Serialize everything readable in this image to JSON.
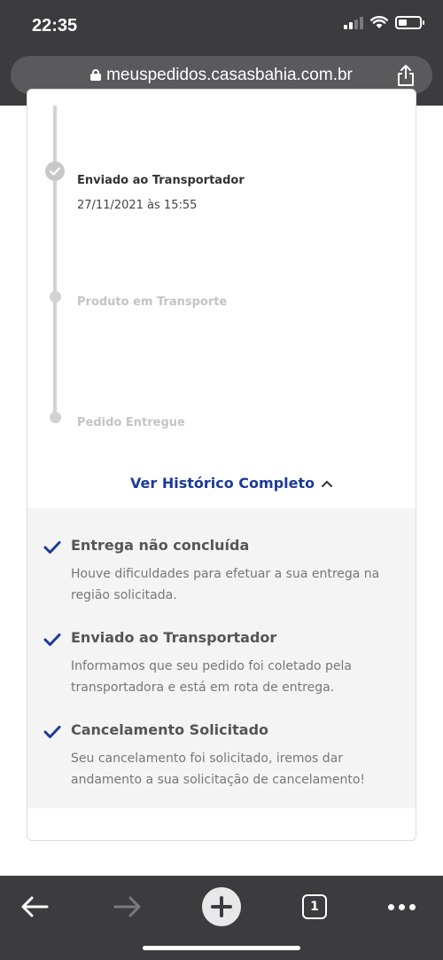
{
  "status_bar": {
    "time": "22:35"
  },
  "browser": {
    "url": "meuspedidos.casasbahia.com.br",
    "tab_count": "1"
  },
  "timeline": {
    "steps": [
      {
        "title": "Enviado ao Transportador",
        "date": "27/11/2021 às 15:55",
        "done": true
      },
      {
        "title": "Produto em Transporte",
        "done": false
      },
      {
        "title": "Pedido Entregue",
        "done": false
      }
    ]
  },
  "history_link": "Ver Histórico Completo",
  "history": [
    {
      "title": "Entrega não concluída",
      "description": "Houve dificuldades para efetuar a sua entrega na região solicitada."
    },
    {
      "title": "Enviado ao Transportador",
      "description": "Informamos que seu pedido foi coletado pela transportadora e está em rota de entrega."
    },
    {
      "title": "Cancelamento Solicitado",
      "description": "Seu cancelamento foi solicitado, iremos dar andamento a sua solicitação de cancelamento!"
    }
  ],
  "colors": {
    "accent": "#1b3a99",
    "chrome": "#3c3c3e"
  }
}
